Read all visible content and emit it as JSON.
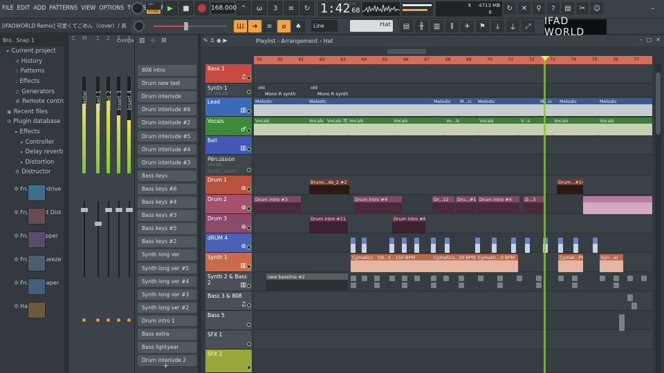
{
  "menu": [
    "FILE",
    "EDIT",
    "ADD",
    "PATTERNS",
    "VIEW",
    "OPTIONS",
    "TOOLS",
    "HELP"
  ],
  "hint": "[IFADWORLD Remix] 可愛くてごめん（cover）/ 高",
  "transport": {
    "pat": "PAT",
    "song": "SONG",
    "tempo": "168.000",
    "time_main": "1:42",
    "time_sub": "68",
    "time_unit": "M:S:CS"
  },
  "cpu": {
    "a": "9",
    "b": "4713 MB",
    "c": "6"
  },
  "snap": "Line",
  "pattern_selector": "Hat",
  "logo": "IFAD WORLD",
  "browser": {
    "head": "Bro.. Snap 1",
    "items": [
      {
        "label": "Current project",
        "level": 0,
        "icon": "folder-icon"
      },
      {
        "label": "History",
        "level": 1,
        "icon": "history-icon"
      },
      {
        "label": "Patterns",
        "level": 1,
        "icon": "pattern-icon"
      },
      {
        "label": "Effects",
        "level": 1,
        "icon": "effects-icon"
      },
      {
        "label": "Generators",
        "level": 1,
        "icon": "generator-icon"
      },
      {
        "label": "Remote control",
        "level": 1,
        "icon": "remote-icon"
      },
      {
        "label": "Recent files",
        "level": 0,
        "icon": "recent-icon"
      },
      {
        "label": "Plugin database",
        "level": 0,
        "icon": "plugin-icon"
      },
      {
        "label": "Effects",
        "level": 1,
        "icon": "folder-icon"
      },
      {
        "label": "Controller",
        "level": 2,
        "icon": "folder-icon"
      },
      {
        "label": "Delay reverb",
        "level": 2,
        "icon": "folder-icon"
      },
      {
        "label": "Distortion",
        "level": 2,
        "icon": "folder-icon"
      },
      {
        "label": "Distructor",
        "level": 1,
        "icon": "plugin-icon"
      }
    ],
    "plugins": [
      "Fruity B..rdrive",
      "Fruity Fast Dist",
      "Fruity..Clipper",
      "Fruity Squeeze",
      "Fruit..eShaper",
      "Hardcore"
    ]
  },
  "mixer": {
    "tab": "Compa",
    "strips": [
      {
        "num": "C",
        "label": ""
      },
      {
        "num": "M",
        "label": "Master"
      },
      {
        "num": "1",
        "label": "Insert 1"
      },
      {
        "num": "2",
        "label": "Insert 2"
      },
      {
        "num": "3",
        "label": "Insert 3"
      },
      {
        "num": "4",
        "label": "Insert 4"
      }
    ],
    "meter_levels": [
      0.0,
      0.72,
      0.72,
      0.75,
      0.6,
      0.55
    ]
  },
  "channels": [
    "808 intro",
    "Drum new test",
    "Drum interlude",
    "Drum interlude #6",
    "Drum interlude #2",
    "Drum interlude #5",
    "Drum interlude #4",
    "Drum interlude #3",
    "Bass keys",
    "Bass keys #6",
    "Bass keys #4",
    "Bass keys #3",
    "Bass keys #5",
    "Bass keys #2",
    "Synth long ver",
    "Synth long ver #5",
    "Synth long ver #4",
    "Synth long ver #3",
    "Synth long ver #2",
    "Drum intro 1",
    "Bass extra",
    "Bass lightyear",
    "Drum interlude 2"
  ],
  "playlist": {
    "title": "Playlist - Arrangement",
    "pattern": "Hat",
    "ruler": [
      "59",
      "60",
      "61",
      "62",
      "63",
      "64",
      "65",
      "66",
      "67",
      "68",
      "69",
      "70",
      "71",
      "72",
      "73",
      "74",
      "75",
      "76",
      "77"
    ],
    "tracks": [
      {
        "name": "Bass 1",
        "color": "#c9493e",
        "icon": "guitar-icon"
      },
      {
        "name": "Synth 1",
        "color": "#3e464c",
        "icon": "none"
      },
      {
        "name": "Lead",
        "color": "#3a6ab8",
        "icon": "keyboard-icon"
      },
      {
        "name": "Vocals",
        "color": "#3d8a3a",
        "icon": "mic-icon"
      },
      {
        "name": "Bell",
        "color": "#4557b5",
        "icon": "keyboard-icon"
      },
      {
        "name": "Percussion",
        "color": "#3e464c",
        "icon": "none"
      },
      {
        "name": "Drum 1",
        "color": "#b6533f",
        "icon": "drum-icon"
      },
      {
        "name": "Drum 2",
        "color": "#a5506d",
        "icon": "drum-icon"
      },
      {
        "name": "Drum 3",
        "color": "#8c4a6a",
        "icon": "drum-icon"
      },
      {
        "name": "dRUM 4",
        "color": "#4a62b6",
        "icon": "drum-icon"
      },
      {
        "name": "Synth 1",
        "color": "#c76b4a",
        "icon": "keyboard-icon"
      },
      {
        "name": "Synth 2 & Bass 2",
        "color": "#4a5058",
        "icon": "keyboard-icon"
      },
      {
        "name": "Bass 3 & 808",
        "color": "#4a5058",
        "icon": "guitar-icon"
      },
      {
        "name": "Bass 5",
        "color": "#4a5058",
        "icon": "none"
      },
      {
        "name": "SFX 1",
        "color": "#4a5058",
        "icon": "none"
      },
      {
        "name": "SFX 2",
        "color": "#99a83a",
        "icon": "none"
      }
    ],
    "sub_labels": [
      "Synth 1",
      "Hi Vocals",
      "Percussion",
      "Vocals",
      "Synth_ honic"
    ],
    "clips": {
      "synth_old": [
        "old",
        "old",
        "Mono R synth",
        "Mono R synth"
      ],
      "lead": [
        "Melodic",
        "Melodic",
        "Melodic",
        "M...ic",
        "Melodic",
        "M...ic",
        "Melodic",
        "Melodic"
      ],
      "vocals": [
        "Vocals",
        "Vocals",
        "Vocals 可愛",
        "Vocals",
        "Vocals",
        "Vo...ls",
        "Vocals",
        "V...s",
        "Vocals",
        "Vocals"
      ],
      "drum1": [
        "Bruno...de_2 #2",
        "Drum...#14"
      ],
      "drum2": [
        "Drum intro #3",
        "Drum intro #4",
        "Dr...12",
        "Dru...#12",
        "Drum intro #4",
        "D...3"
      ],
      "drum3": [
        "Drum intro #11",
        "Drum intro #6"
      ],
      "synth1": [
        "Cymatics - Od...4 - 150 BPM",
        "Cymatics...50 BPM",
        "Cymatic...0 BPM",
        "Cymat...PM",
        "Syn...er"
      ],
      "synth2": [
        "new bassline #2"
      ]
    }
  }
}
